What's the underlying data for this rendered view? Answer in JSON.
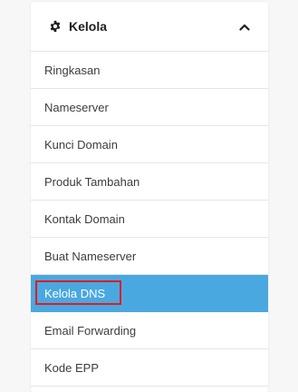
{
  "panel": {
    "title": "Kelola",
    "header_icon": "gear-icon",
    "toggle_icon": "chevron-up-icon"
  },
  "menu": {
    "items": [
      {
        "label": "Ringkasan"
      },
      {
        "label": "Nameserver"
      },
      {
        "label": "Kunci Domain"
      },
      {
        "label": "Produk Tambahan"
      },
      {
        "label": "Kontak Domain"
      },
      {
        "label": "Buat Nameserver"
      },
      {
        "label": "Kelola DNS"
      },
      {
        "label": "Email Forwarding"
      },
      {
        "label": "Kode EPP"
      }
    ],
    "active_index": 6
  },
  "colors": {
    "active_bg": "#4aa8e0",
    "highlight_border": "#e01b24",
    "text": "#3c3c3c",
    "divider": "#e6e6e6"
  }
}
